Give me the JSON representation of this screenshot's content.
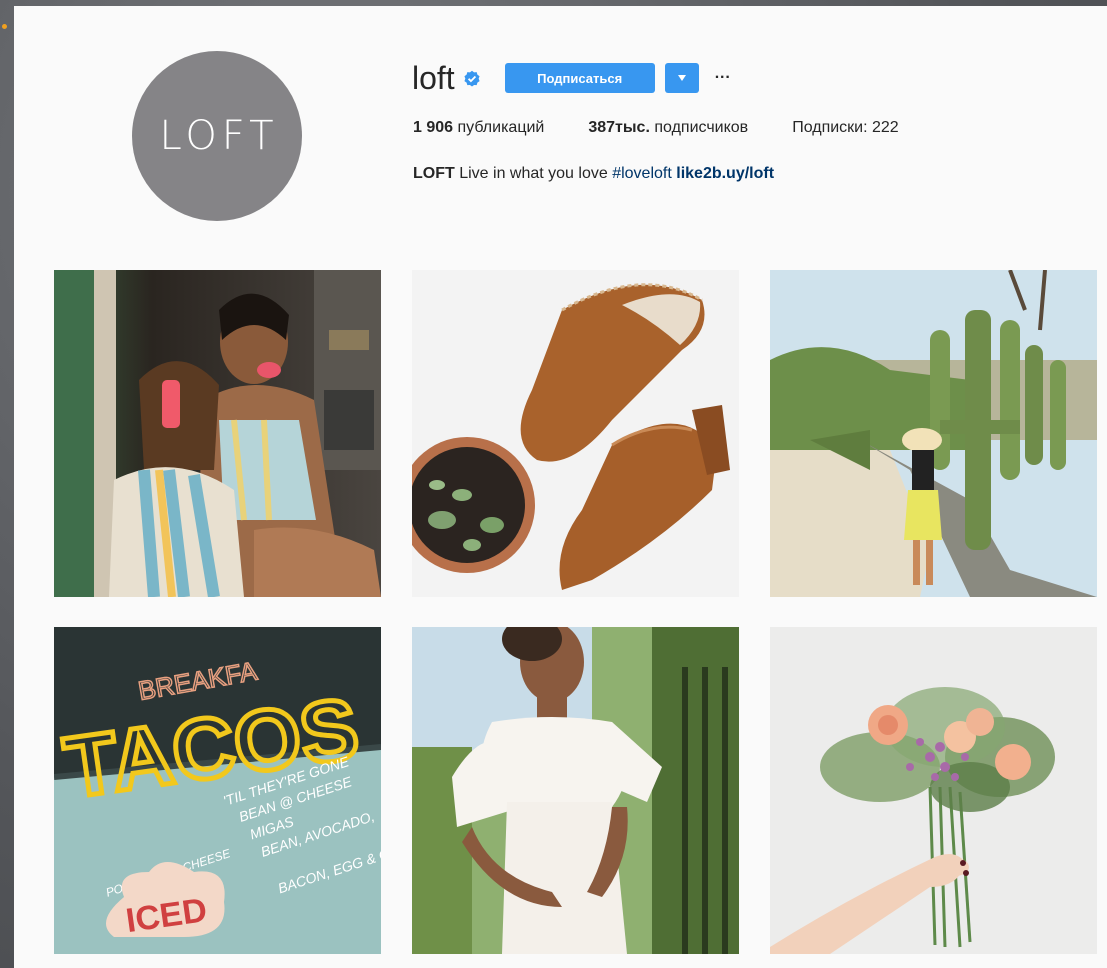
{
  "profile": {
    "avatar_text": "LOFT",
    "username": "loft",
    "follow_label": "Подписаться",
    "more_label": "···",
    "stats": {
      "posts_count": "1 906",
      "posts_label": "публикаций",
      "followers_count": "387тыс.",
      "followers_label": "подписчиков",
      "following": "Подписки: 222"
    },
    "bio": {
      "name": "LOFT",
      "text": "Live in what you love",
      "hashtag": "#loveloft",
      "link": "like2b.uy/loft"
    }
  },
  "colors": {
    "accent": "#3897f0",
    "verified": "#3897f0",
    "link": "#003569",
    "avatar_bg": "#858487"
  },
  "posts": [
    {
      "name": "post-two-women-popsicles"
    },
    {
      "name": "post-brown-suede-mules"
    },
    {
      "name": "post-woman-by-cactus"
    },
    {
      "name": "post-tacos-neon-sign"
    },
    {
      "name": "post-woman-white-dress"
    },
    {
      "name": "post-flower-bouquet"
    }
  ],
  "tacos_sign": {
    "neon_word": "TACOS",
    "breakfast_word": "BREAKFA",
    "lines": [
      "'TIL THEY'RE GONE",
      "BEAN @ CHEESE",
      "MIGAS",
      "BEAN, AVOCADO,",
      "BACON, EGG & CH"
    ],
    "small": "POTATO,EGG,CHEESE",
    "iced": "ICED"
  }
}
